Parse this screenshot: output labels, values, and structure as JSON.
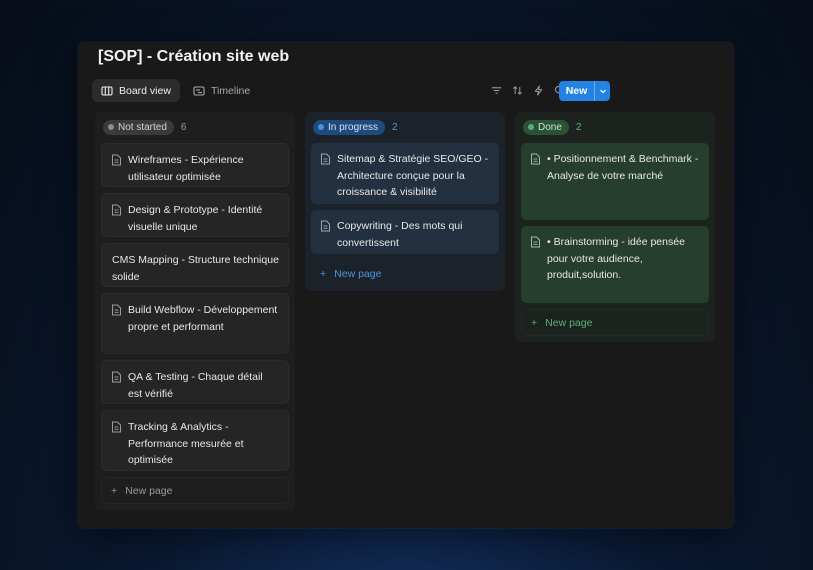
{
  "board": {
    "title": "[SOP] - Création site web",
    "tabs": [
      "Board view",
      "Timeline"
    ],
    "new_button": "New",
    "new_page_label": "New page"
  },
  "columns": [
    {
      "status": "Not started",
      "count": "6",
      "cards": [
        "Wireframes - Expérience utilisateur optimisée",
        "Design & Prototype - Identité visuelle unique",
        "CMS Mapping - Structure technique solide",
        "Build Webflow - Développement propre et performant",
        "QA & Testing - Chaque détail est vérifié",
        "Tracking & Analytics - Performance mesurée et optimisée"
      ]
    },
    {
      "status": "In progress",
      "count": "2",
      "cards": [
        "Sitemap & Stratégie SEO/GEO - Architecture conçue pour la croissance & visibilité",
        "Copywriting - Des mots qui convertissent"
      ]
    },
    {
      "status": "Done",
      "count": "2",
      "cards": [
        "• Positionnement & Benchmark - Analyse de votre marché",
        "• Brainstorming - idée pensée pour votre audience, produit,solution."
      ]
    }
  ],
  "toolbar_icons": [
    "filter-icon",
    "sort-icon",
    "automation-icon",
    "search-icon",
    "expand-icon",
    "settings-icon"
  ],
  "colors": {
    "accent": "#2383e2",
    "in_progress": "#4d94e0",
    "done": "#5bb07a",
    "not_started": "#8f8f8f"
  }
}
